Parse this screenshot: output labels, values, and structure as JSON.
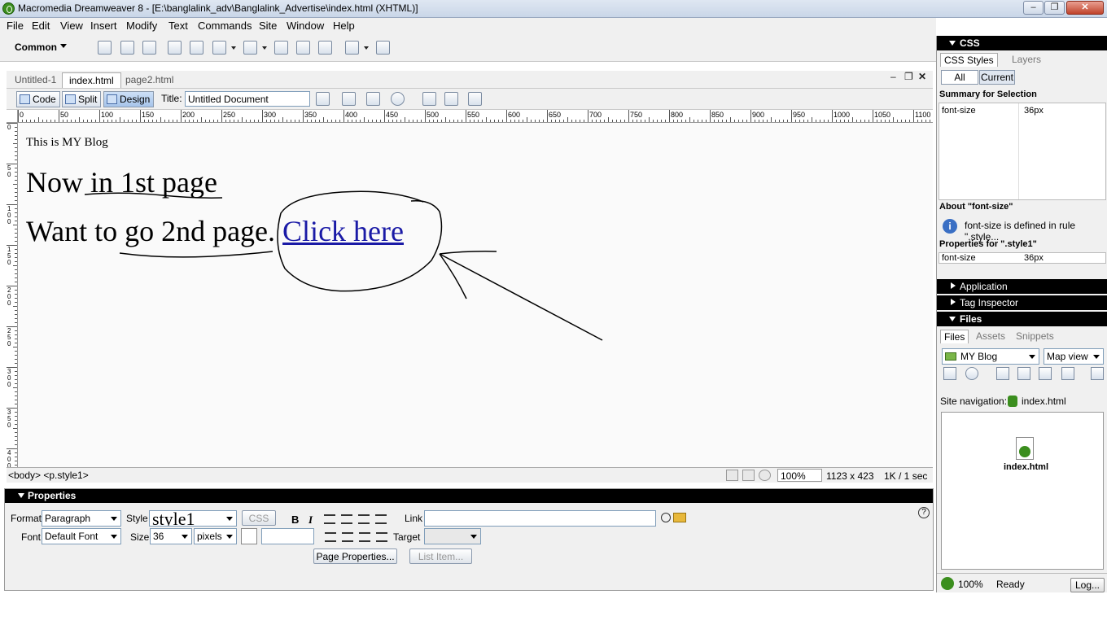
{
  "window": {
    "title": "Macromedia Dreamweaver 8 - [E:\\banglalink_adv\\Banglalink_Advertise\\index.html (XHTML)]"
  },
  "menubar": [
    "File",
    "Edit",
    "View",
    "Insert",
    "Modify",
    "Text",
    "Commands",
    "Site",
    "Window",
    "Help"
  ],
  "insert_bar": {
    "category": "Common"
  },
  "document_tabs": [
    {
      "label": "Untitled-1",
      "active": false
    },
    {
      "label": "index.html",
      "active": true
    },
    {
      "label": "page2.html",
      "active": false
    }
  ],
  "doc_toolbar": {
    "code_label": "Code",
    "split_label": "Split",
    "design_label": "Design",
    "title_label": "Title:",
    "title_value": "Untitled Document"
  },
  "ruler": {
    "h_labels": [
      "0",
      "50",
      "100",
      "150",
      "200",
      "250",
      "300",
      "350",
      "400",
      "450",
      "500",
      "550",
      "600",
      "650",
      "700",
      "750",
      "800",
      "850",
      "900",
      "950",
      "1000",
      "1050",
      "1100"
    ],
    "v_labels": [
      "0",
      "50",
      "100",
      "150",
      "200",
      "250",
      "300",
      "350",
      "400"
    ]
  },
  "design": {
    "line1": "This is MY Blog",
    "line2": "Now in 1st page",
    "line3": "Want to go 2nd page.",
    "link_text": "Click here"
  },
  "tag_bar": {
    "path": "<body> <p.style1>",
    "zoom": "100%",
    "window_size": "1123 x 423",
    "download": "1K / 1 sec"
  },
  "properties": {
    "title": "Properties",
    "format_label": "Format",
    "format_value": "Paragraph",
    "style_label": "Style",
    "style_value": "style1",
    "css_btn": "CSS",
    "bold": "B",
    "italic": "I",
    "link_label": "Link",
    "link_value": "",
    "font_label": "Font",
    "font_value": "Default Font",
    "size_label": "Size",
    "size_value": "36",
    "unit_value": "pixels",
    "target_label": "Target",
    "page_props_btn": "Page Properties...",
    "list_item_btn": "List Item..."
  },
  "right_panel": {
    "css_group": "CSS",
    "css_tabs": [
      "CSS Styles",
      "Layers"
    ],
    "all_btn": "All",
    "current_btn": "Current",
    "summary_title": "Summary for Selection",
    "summary_prop": "font-size",
    "summary_val": "36px",
    "about_title": "About \"font-size\"",
    "about_text": "font-size is defined in rule \".style...",
    "props_for": "Properties for \".style1\"",
    "props_prop": "font-size",
    "props_val": "36px",
    "application_group": "Application",
    "tag_inspector_group": "Tag Inspector",
    "files_group": "Files",
    "files_tabs": [
      "Files",
      "Assets",
      "Snippets"
    ],
    "site_select": "MY Blog",
    "view_select": "Map view",
    "site_nav_label": "Site navigation:",
    "site_nav_file": "index.html",
    "map_file": "index.html",
    "zoom": "100%",
    "status": "Ready",
    "log_btn": "Log..."
  },
  "colors": {
    "link": "#1a1aa6",
    "panel_head": "#000000",
    "ui_bg": "#f0f0f0"
  }
}
